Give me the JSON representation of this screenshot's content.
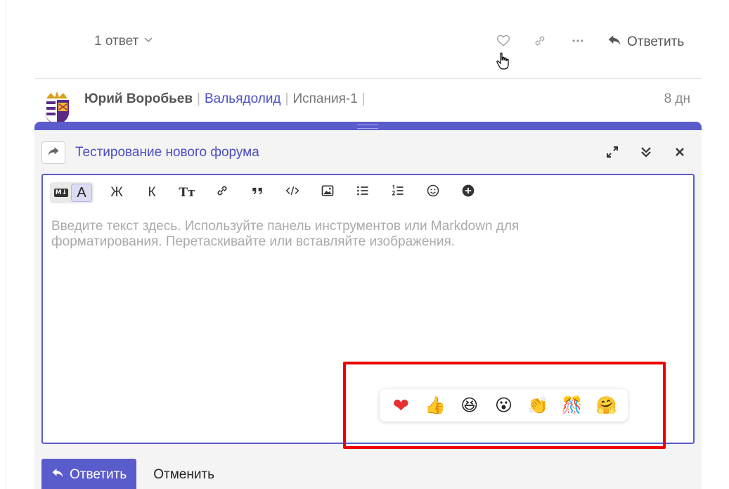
{
  "post": {
    "replies_label": "1 ответ",
    "reply_label": "Ответить"
  },
  "reply_header": {
    "author": "Юрий Воробьев",
    "club": "Вальядолид",
    "league": "Испания-1",
    "separator": "|",
    "time": "8 дн"
  },
  "composer": {
    "topic_title": "Тестирование нового форума",
    "placeholder": "Введите текст здесь. Используйте панель инструментов или Markdown для форматирования. Перетаскивайте или вставляйте изображения.",
    "toolbar": {
      "markdown_label": "M↓",
      "rich_label": "A",
      "bold_label": "Ж",
      "italic_label": "К",
      "heading_label": "Тт"
    },
    "submit_label": "Ответить",
    "cancel_label": "Отменить"
  },
  "reactions": [
    "❤",
    "👍",
    "😆",
    "😮",
    "👏",
    "🎊",
    "🤗"
  ],
  "colors": {
    "accent": "#5b5ccc",
    "link": "#4a4fc4",
    "highlight": "#ee0000"
  }
}
